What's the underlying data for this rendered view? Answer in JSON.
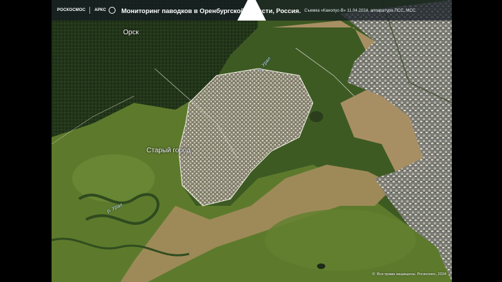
{
  "header": {
    "logo_roscosmos": "РОСКОСМОС",
    "logo_arks": "АРКС",
    "title": "Мониторинг паводков в Оренбургской области, Россия.",
    "subtitle": "Съемка «Канопус-В» 11.04.2024, аппаратура ПСС, МСС"
  },
  "map_labels": {
    "orsk": "Орск",
    "old_town": "Старый город",
    "river_ural_top": "р. Урал",
    "river_ural_left": "р. Урал"
  },
  "footer": {
    "copyright": "Все права защищены. Роскосмос, 2024"
  },
  "colors": {
    "flood_water": "#a88f63",
    "green_water": "#5f7a2e",
    "vegetation": "#2f4a1c",
    "header_bg": "#141a22"
  }
}
